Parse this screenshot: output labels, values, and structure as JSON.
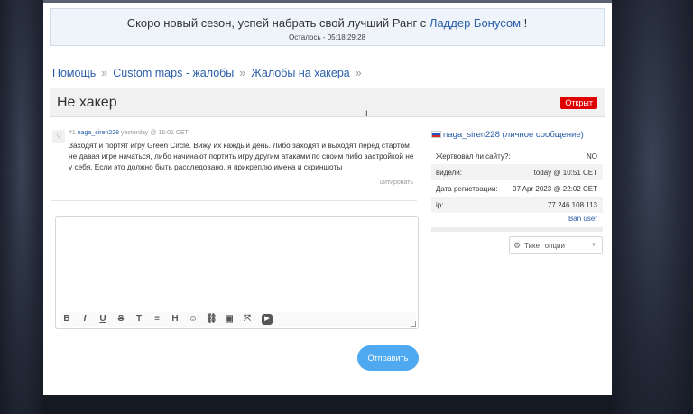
{
  "banner": {
    "text_before": "Скоро новый сезон, успей набрать свой лучший Ранг с ",
    "link": "Ладдер Бонусом",
    "text_after": " !",
    "timer": "Осталось - 05:18:29:28"
  },
  "breadcrumb": {
    "items": [
      "Помощь",
      "Custom maps - жалобы",
      "Жалобы на хакера"
    ],
    "separator": "»"
  },
  "ticket": {
    "title": "Не хакер",
    "status": "Открыт"
  },
  "post": {
    "number": "#1",
    "author": "naga_siren228",
    "time": "yesterday @ 16:01 CET",
    "body": "Заходят и портят игру Green Circle. Вижу их каждый день. Либо заходят и выходят перед стартом не давая игре начаться, либо начинают портить игру другим атаками по своим либо застройкой не у себя. Если это должно быть расследовано, я прикреплю имена и скриншоты",
    "quote_label": "цитировать"
  },
  "reply": {
    "send_label": "Отправить",
    "toolbar": [
      "B",
      "I",
      "U",
      "S",
      "T",
      "≡",
      "H",
      "☺",
      "⛓",
      "▣",
      "⤧",
      "▶"
    ]
  },
  "sidebar": {
    "user": "naga_siren228",
    "user_suffix": "(личное сообщение)",
    "rows": [
      {
        "label": "Жертвовал ли сайту?:",
        "value": "NO"
      },
      {
        "label": "видели:",
        "value": "today @ 10:51 CET"
      },
      {
        "label": "Дата регистрации:",
        "value": "07 Apr 2023 @ 22:02 CET"
      },
      {
        "label": "ip:",
        "value": "77.246.108.113"
      }
    ],
    "ban_label": "Ban user",
    "ticket_options": "Тикет опции"
  },
  "colors": {
    "link": "#2a5ea8",
    "status_badge": "#e00000",
    "send_button": "#4fa9f0"
  }
}
